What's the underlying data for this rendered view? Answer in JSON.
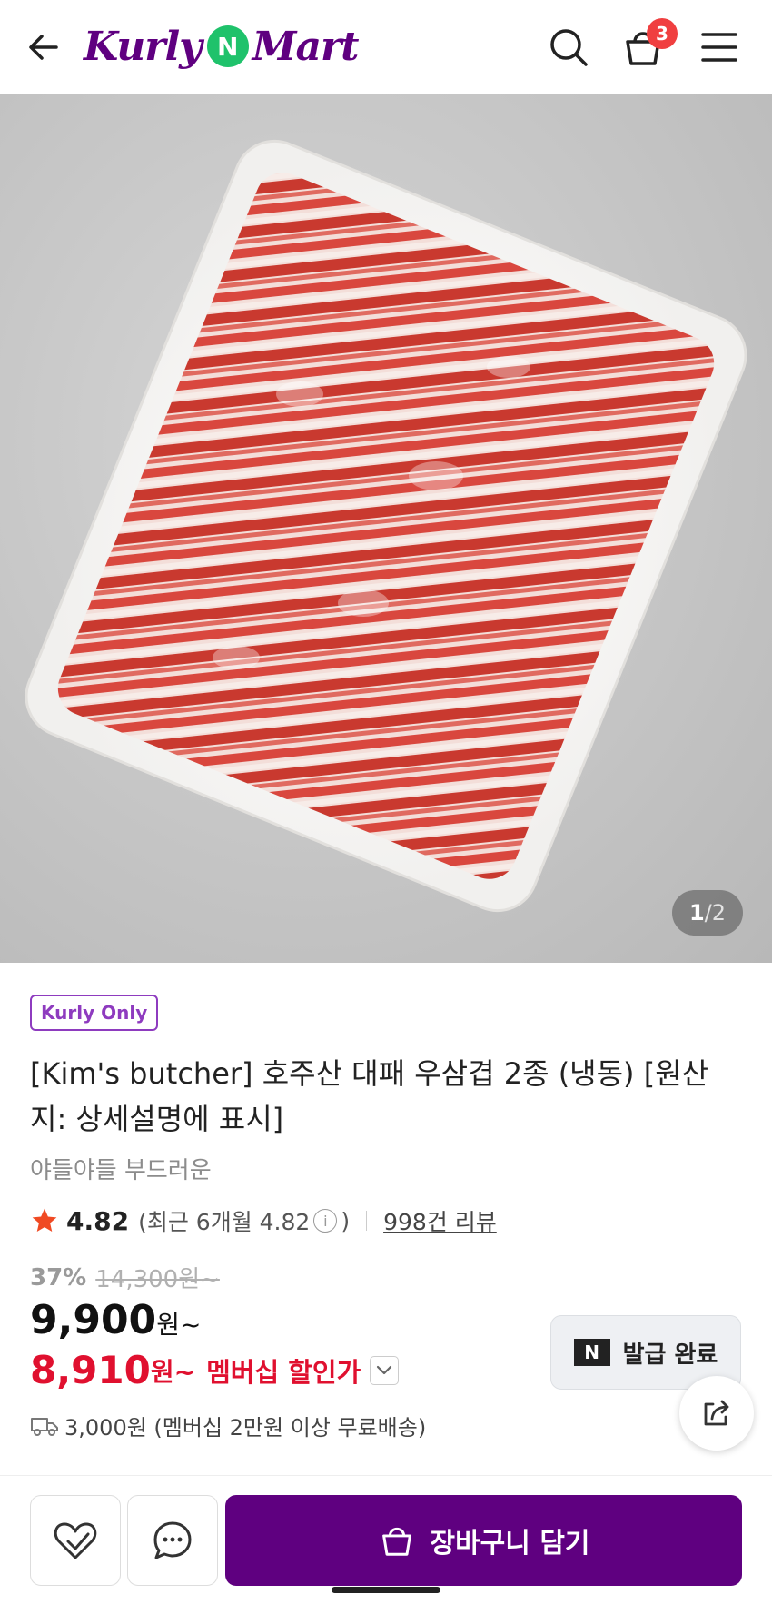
{
  "header": {
    "logo_left": "Kurly",
    "logo_n": "N",
    "logo_right": "Mart",
    "cart_count": "3",
    "icons": [
      "back-arrow-icon",
      "search-icon",
      "cart-icon",
      "menu-icon"
    ]
  },
  "gallery": {
    "current": "1",
    "separator": "/",
    "total": "2"
  },
  "product": {
    "tag": "Kurly Only",
    "title": "[Kim's butcher] 호주산 대패 우삼겹 2종 (냉동) [원산지: 상세설명에 표시]",
    "subtitle": "야들야들 부드러운",
    "rating": "4.82",
    "recent_rating": "(최근 6개월 4.82",
    "recent_close": ")",
    "info_glyph": "i",
    "reviews": "998건 리뷰",
    "discount": "37%",
    "original_price": "14,300원~",
    "price_num": "9,900",
    "price_unit": "원~",
    "member_price_num": "8,910",
    "member_price_unit": "원~",
    "member_label": "멤버십 할인가",
    "shipping": "3,000원 (멤버십 2만원 이상 무료배송)",
    "coupon_logo": "N",
    "coupon_label": "발급 완료"
  },
  "bottom": {
    "add_to_cart": "장바구니 담기"
  },
  "colors": {
    "brand": "#5f0080",
    "member_red": "#e0102f",
    "badge_red": "#f03f40",
    "logo_green": "#1fc26b",
    "star": "#f04a23"
  }
}
